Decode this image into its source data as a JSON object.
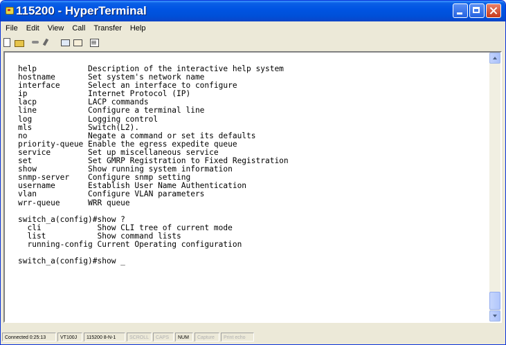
{
  "window": {
    "title": "115200 - HyperTerminal"
  },
  "menu": {
    "items": [
      "File",
      "Edit",
      "View",
      "Call",
      "Transfer",
      "Help"
    ]
  },
  "toolbar": {
    "icons": [
      "new-icon",
      "open-icon",
      "connect-icon",
      "disconnect-icon",
      "send-icon",
      "receive-icon",
      "properties-icon"
    ]
  },
  "terminal": {
    "lines": [
      "help           Description of the interactive help system",
      "hostname       Set system's network name",
      "interface      Select an interface to configure",
      "ip             Internet Protocol (IP)",
      "lacp           LACP commands",
      "line           Configure a terminal line",
      "log            Logging control",
      "mls            Switch(L2).",
      "no             Negate a command or set its defaults",
      "priority-queue Enable the egress expedite queue",
      "service        Set up miscellaneous service",
      "set            Set GMRP Registration to Fixed Registration",
      "show           Show running system information",
      "snmp-server    Configure snmp setting",
      "username       Establish User Name Authentication",
      "vlan           Configure VLAN parameters",
      "wrr-queue      WRR queue",
      "",
      "switch_a(config)#show ?",
      "  cli            Show CLI tree of current mode",
      "  list           Show command lists",
      "  running-config Current Operating configuration",
      "",
      "switch_a(config)#show _"
    ]
  },
  "statusbar": {
    "connected": "Connected 0:25:13",
    "emulation": "VT100J",
    "settings": "115200 8-N-1",
    "scroll": "SCROLL",
    "caps": "CAPS",
    "num": "NUM",
    "capture": "Capture",
    "print_echo": "Print echo"
  }
}
